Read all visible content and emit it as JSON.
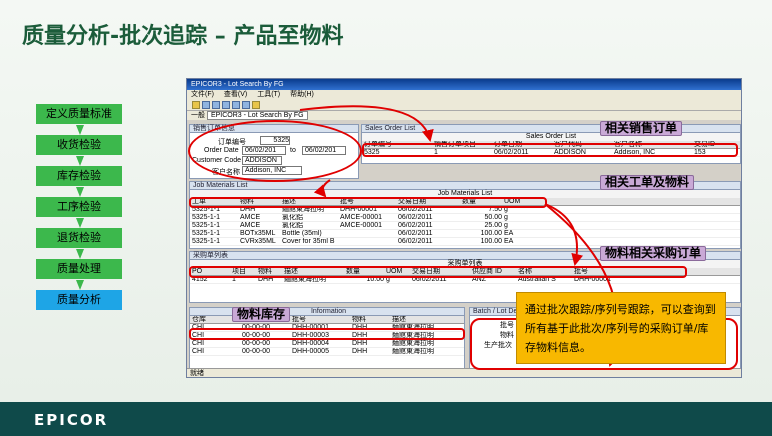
{
  "title": "质量分析-批次追踪 – 产品至物料",
  "footer": {
    "logo": "EPICOR"
  },
  "steps": [
    {
      "label": "定义质量标准"
    },
    {
      "label": "收货检验"
    },
    {
      "label": "库存检验"
    },
    {
      "label": "工序检验"
    },
    {
      "label": "退货检验"
    },
    {
      "label": "质量处理"
    },
    {
      "label": "质量分析",
      "active": true
    }
  ],
  "window": {
    "title": "EPICOR3 - Lot Search By FG",
    "menu": [
      "文件(F)",
      "查看(V)",
      "工具(T)",
      "帮助(H)"
    ],
    "tabs": {
      "first": "一般",
      "selected": "EPICOR3 - Lot Search By FG"
    },
    "sales_order_section": "Sales Order List",
    "sales_order_subtitle": "销售订单信息",
    "fields": {
      "order_num_label": "订单编号",
      "order_num_value": "5325",
      "order_date_label": "Order Date",
      "order_date_from": "06/02/201",
      "to_label": "to",
      "order_date_to": "06/02/201",
      "customer_code_label": "Customer Code",
      "customer_code_value": "ADDISON",
      "customer_name_label": "客户名称",
      "customer_name_value": "Addison, INC"
    },
    "sales_list": {
      "header": "Sales Order List",
      "caption": "Sales Order List",
      "columns": [
        "订单编号",
        "销售订单项目",
        "订单日期",
        "客户代码",
        "客户名称",
        "交易ID"
      ],
      "rows": [
        [
          "5325",
          "1",
          "06/02/2011",
          "ADDISON",
          "Addison, INC",
          "153"
        ]
      ]
    },
    "job_list": {
      "header": "Job Materials List",
      "caption": "Job Materials List",
      "columns": [
        "工单",
        "物料",
        "描述",
        "批号",
        "交易日期",
        "数量",
        "UOM"
      ],
      "rows": [
        [
          "5325-1-1",
          "DHH",
          "麵館東海拉明",
          "DHH-00001",
          "06/02/2011",
          "7.50",
          "g"
        ],
        [
          "5325-1-1",
          "AMCE",
          "氯化鋁",
          "AMCE-00001",
          "06/02/2011",
          "50.00",
          "g"
        ],
        [
          "5325-1-1",
          "AMCE",
          "氯化鋁",
          "AMCE-00001",
          "06/02/2011",
          "25.00",
          "g"
        ],
        [
          "5325-1-1",
          "BOTx35ML",
          "Bottle (35ml)",
          "",
          "06/02/2011",
          "100.00",
          "EA"
        ],
        [
          "5325-1-1",
          "CVRx35ML",
          "Cover for 35ml B",
          "",
          "06/02/2011",
          "100.00",
          "EA"
        ]
      ]
    },
    "po_list": {
      "header": "采购单列表",
      "caption": "采购单列表",
      "columns": [
        "PO",
        "项目",
        "物料",
        "描述",
        "数量",
        "UOM",
        "交易日期",
        "供应商 ID",
        "名称",
        "批号"
      ],
      "rows": [
        [
          "4152",
          "1",
          "DHH",
          "麵館東海拉明",
          "10.00",
          "g",
          "06/02/2011",
          "ANZ",
          "Australian S",
          "DHH-00001"
        ]
      ]
    },
    "inv_list": {
      "header": "Information",
      "columns": [
        "仓库",
        "库位",
        "批号",
        "物料",
        "描述"
      ],
      "rows": [
        [
          "CHI",
          "00-00-00",
          "DHH-00001",
          "DHH",
          "麵館東海拉明"
        ],
        [
          "CHI",
          "00-00-00",
          "DHH-00003",
          "DHH",
          "麵館東海拉明"
        ],
        [
          "CHI",
          "00-00-00",
          "DHH-00004",
          "DHH",
          "麵館東海拉明"
        ],
        [
          "CHI",
          "00-00-00",
          "DHH-00005",
          "DHH",
          "麵館東海拉明"
        ]
      ]
    },
    "batch_panel": {
      "header": "Batch / Lot Det",
      "labels": [
        "批号",
        "物料",
        "生产批次"
      ]
    },
    "status": "就绪"
  },
  "callouts": {
    "sales": "相关销售订单",
    "job": "相关工单及物料",
    "po": "物料相关采购订单",
    "inventory": "物料库存"
  },
  "note": "通过批次跟踪/序列号跟踪，可以查询到所有基于此批次/序列号的采购订单/库存物料信息。",
  "colors": {
    "title": "#1b5c3a",
    "step": "#3cb84c",
    "step_active": "#1ea5e6",
    "callout": "#c9a9d6",
    "note": "#f8b800",
    "highlight": "#e00000",
    "footer": "#0f4a4a"
  }
}
